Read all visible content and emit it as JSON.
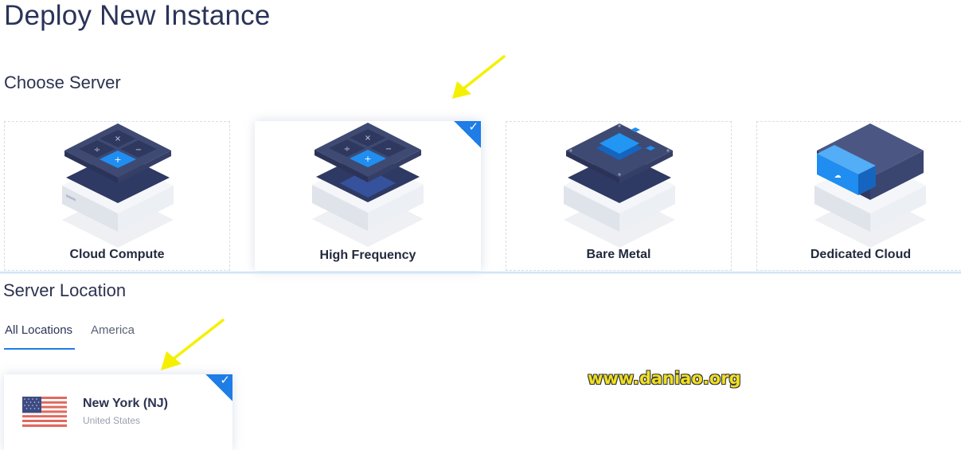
{
  "page": {
    "title": "Deploy New Instance"
  },
  "choose_server": {
    "heading": "Choose Server",
    "cards": [
      {
        "label": "Cloud Compute",
        "icon": "calculator-server-icon",
        "selected": false
      },
      {
        "label": "High Frequency",
        "icon": "calculator-server-icon",
        "selected": true
      },
      {
        "label": "Bare Metal",
        "icon": "chip-server-icon",
        "selected": false
      },
      {
        "label": "Dedicated Cloud",
        "icon": "cloud-server-icon",
        "selected": false
      }
    ]
  },
  "server_location": {
    "heading": "Server Location",
    "tabs": [
      {
        "label": "All Locations",
        "active": true
      },
      {
        "label": "America",
        "active": false
      }
    ],
    "locations": [
      {
        "name": "New York (NJ)",
        "country": "United States",
        "flag": "us-flag-icon",
        "selected": true
      }
    ]
  },
  "watermark": {
    "text": "www.daniao.org"
  },
  "colors": {
    "accent": "#1e7de6",
    "title": "#2a3358",
    "annotation_arrow": "#f5f000",
    "watermark": "#f0e020"
  }
}
